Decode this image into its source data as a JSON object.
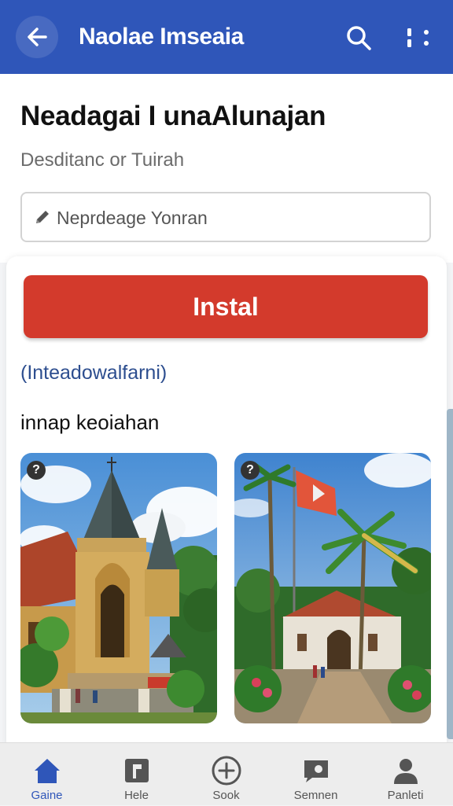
{
  "app_bar": {
    "title": "Naolae Imseaia",
    "back_icon": "arrow-left-icon",
    "search_icon": "search-icon",
    "more_icon": "more-vert-icon",
    "color": "#2f56b9"
  },
  "page": {
    "title": "Neadagai I unaAlunajan",
    "subtitle": "Desditanc or Tuirah"
  },
  "input": {
    "placeholder": "Neprdeage Yonran",
    "value": "",
    "icon": "pencil-icon"
  },
  "card": {
    "install_label": "Instal",
    "install_color": "#d33a2c",
    "link_text": "(Inteadowalfarni)",
    "section_label": "innap keoiahan",
    "photos": [
      {
        "badge": "?",
        "subject": "temple-with-spires"
      },
      {
        "badge": "?",
        "subject": "palms-flag-building"
      }
    ]
  },
  "bottom_nav": {
    "items": [
      {
        "label": "Gaine",
        "icon": "home-icon",
        "active": true
      },
      {
        "label": "Hele",
        "icon": "document-icon",
        "active": false
      },
      {
        "label": "Sook",
        "icon": "add-circle-icon",
        "active": false
      },
      {
        "label": "Semnen",
        "icon": "chat-icon",
        "active": false
      },
      {
        "label": "Panleti",
        "icon": "person-icon",
        "active": false
      }
    ]
  }
}
